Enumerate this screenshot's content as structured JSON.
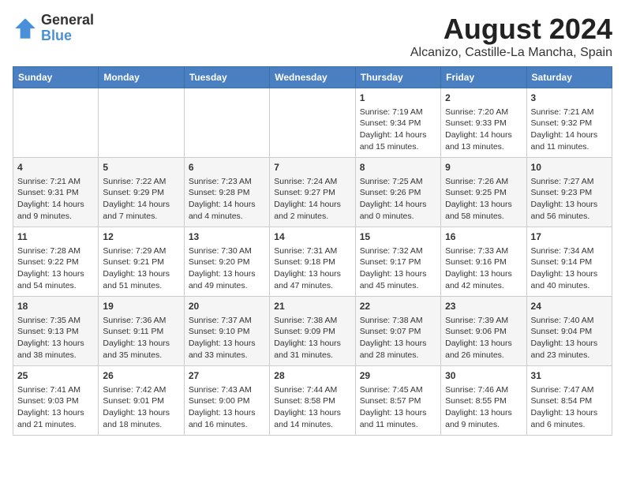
{
  "header": {
    "logo_general": "General",
    "logo_blue": "Blue",
    "main_title": "August 2024",
    "subtitle": "Alcanizo, Castille-La Mancha, Spain"
  },
  "days_of_week": [
    "Sunday",
    "Monday",
    "Tuesday",
    "Wednesday",
    "Thursday",
    "Friday",
    "Saturday"
  ],
  "weeks": [
    [
      {
        "day": "",
        "content": ""
      },
      {
        "day": "",
        "content": ""
      },
      {
        "day": "",
        "content": ""
      },
      {
        "day": "",
        "content": ""
      },
      {
        "day": "1",
        "content": "Sunrise: 7:19 AM\nSunset: 9:34 PM\nDaylight: 14 hours\nand 15 minutes."
      },
      {
        "day": "2",
        "content": "Sunrise: 7:20 AM\nSunset: 9:33 PM\nDaylight: 14 hours\nand 13 minutes."
      },
      {
        "day": "3",
        "content": "Sunrise: 7:21 AM\nSunset: 9:32 PM\nDaylight: 14 hours\nand 11 minutes."
      }
    ],
    [
      {
        "day": "4",
        "content": "Sunrise: 7:21 AM\nSunset: 9:31 PM\nDaylight: 14 hours\nand 9 minutes."
      },
      {
        "day": "5",
        "content": "Sunrise: 7:22 AM\nSunset: 9:29 PM\nDaylight: 14 hours\nand 7 minutes."
      },
      {
        "day": "6",
        "content": "Sunrise: 7:23 AM\nSunset: 9:28 PM\nDaylight: 14 hours\nand 4 minutes."
      },
      {
        "day": "7",
        "content": "Sunrise: 7:24 AM\nSunset: 9:27 PM\nDaylight: 14 hours\nand 2 minutes."
      },
      {
        "day": "8",
        "content": "Sunrise: 7:25 AM\nSunset: 9:26 PM\nDaylight: 14 hours\nand 0 minutes."
      },
      {
        "day": "9",
        "content": "Sunrise: 7:26 AM\nSunset: 9:25 PM\nDaylight: 13 hours\nand 58 minutes."
      },
      {
        "day": "10",
        "content": "Sunrise: 7:27 AM\nSunset: 9:23 PM\nDaylight: 13 hours\nand 56 minutes."
      }
    ],
    [
      {
        "day": "11",
        "content": "Sunrise: 7:28 AM\nSunset: 9:22 PM\nDaylight: 13 hours\nand 54 minutes."
      },
      {
        "day": "12",
        "content": "Sunrise: 7:29 AM\nSunset: 9:21 PM\nDaylight: 13 hours\nand 51 minutes."
      },
      {
        "day": "13",
        "content": "Sunrise: 7:30 AM\nSunset: 9:20 PM\nDaylight: 13 hours\nand 49 minutes."
      },
      {
        "day": "14",
        "content": "Sunrise: 7:31 AM\nSunset: 9:18 PM\nDaylight: 13 hours\nand 47 minutes."
      },
      {
        "day": "15",
        "content": "Sunrise: 7:32 AM\nSunset: 9:17 PM\nDaylight: 13 hours\nand 45 minutes."
      },
      {
        "day": "16",
        "content": "Sunrise: 7:33 AM\nSunset: 9:16 PM\nDaylight: 13 hours\nand 42 minutes."
      },
      {
        "day": "17",
        "content": "Sunrise: 7:34 AM\nSunset: 9:14 PM\nDaylight: 13 hours\nand 40 minutes."
      }
    ],
    [
      {
        "day": "18",
        "content": "Sunrise: 7:35 AM\nSunset: 9:13 PM\nDaylight: 13 hours\nand 38 minutes."
      },
      {
        "day": "19",
        "content": "Sunrise: 7:36 AM\nSunset: 9:11 PM\nDaylight: 13 hours\nand 35 minutes."
      },
      {
        "day": "20",
        "content": "Sunrise: 7:37 AM\nSunset: 9:10 PM\nDaylight: 13 hours\nand 33 minutes."
      },
      {
        "day": "21",
        "content": "Sunrise: 7:38 AM\nSunset: 9:09 PM\nDaylight: 13 hours\nand 31 minutes."
      },
      {
        "day": "22",
        "content": "Sunrise: 7:38 AM\nSunset: 9:07 PM\nDaylight: 13 hours\nand 28 minutes."
      },
      {
        "day": "23",
        "content": "Sunrise: 7:39 AM\nSunset: 9:06 PM\nDaylight: 13 hours\nand 26 minutes."
      },
      {
        "day": "24",
        "content": "Sunrise: 7:40 AM\nSunset: 9:04 PM\nDaylight: 13 hours\nand 23 minutes."
      }
    ],
    [
      {
        "day": "25",
        "content": "Sunrise: 7:41 AM\nSunset: 9:03 PM\nDaylight: 13 hours\nand 21 minutes."
      },
      {
        "day": "26",
        "content": "Sunrise: 7:42 AM\nSunset: 9:01 PM\nDaylight: 13 hours\nand 18 minutes."
      },
      {
        "day": "27",
        "content": "Sunrise: 7:43 AM\nSunset: 9:00 PM\nDaylight: 13 hours\nand 16 minutes."
      },
      {
        "day": "28",
        "content": "Sunrise: 7:44 AM\nSunset: 8:58 PM\nDaylight: 13 hours\nand 14 minutes."
      },
      {
        "day": "29",
        "content": "Sunrise: 7:45 AM\nSunset: 8:57 PM\nDaylight: 13 hours\nand 11 minutes."
      },
      {
        "day": "30",
        "content": "Sunrise: 7:46 AM\nSunset: 8:55 PM\nDaylight: 13 hours\nand 9 minutes."
      },
      {
        "day": "31",
        "content": "Sunrise: 7:47 AM\nSunset: 8:54 PM\nDaylight: 13 hours\nand 6 minutes."
      }
    ]
  ]
}
